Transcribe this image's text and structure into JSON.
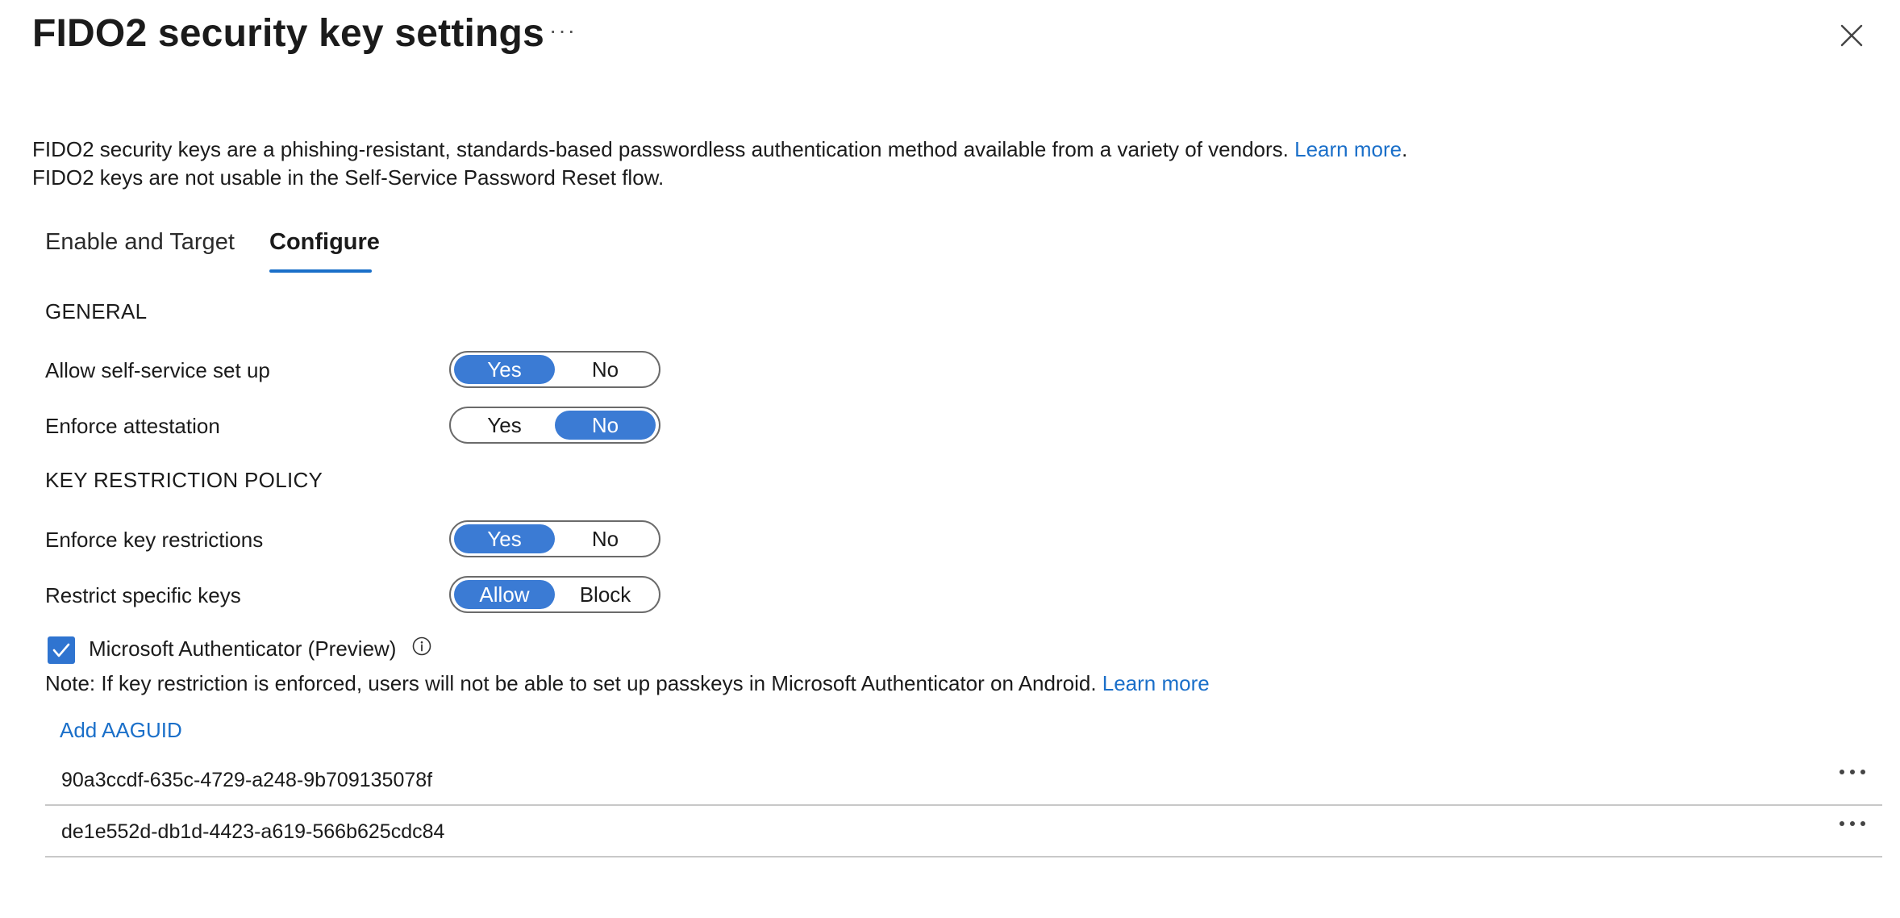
{
  "header": {
    "title": "FIDO2 security key settings",
    "more": "···"
  },
  "description": {
    "line1": "FIDO2 security keys are a phishing-resistant, standards-based passwordless authentication method available from a variety of vendors. ",
    "learn_more": "Learn more",
    "period": ".",
    "line2": "FIDO2 keys are not usable in the Self-Service Password Reset flow."
  },
  "tabs": [
    {
      "label": "Enable and Target",
      "selected": false
    },
    {
      "label": "Configure",
      "selected": true
    }
  ],
  "general": {
    "heading": "GENERAL",
    "allow_self_service": {
      "label": "Allow self-service set up",
      "options": [
        "Yes",
        "No"
      ],
      "selected": "Yes"
    },
    "enforce_attestation": {
      "label": "Enforce attestation",
      "options": [
        "Yes",
        "No"
      ],
      "selected": "No"
    }
  },
  "key_restriction": {
    "heading": "KEY RESTRICTION POLICY",
    "enforce_key_restrictions": {
      "label": "Enforce key restrictions",
      "options": [
        "Yes",
        "No"
      ],
      "selected": "Yes"
    },
    "restrict_specific_keys": {
      "label": "Restrict specific keys",
      "options": [
        "Allow",
        "Block"
      ],
      "selected": "Allow"
    }
  },
  "authenticator": {
    "label": "Microsoft Authenticator (Preview)",
    "checked": true
  },
  "note": {
    "text": "Note: If key restriction is enforced, users will not be able to set up passkeys in Microsoft Authenticator on Android. ",
    "learn_more": "Learn more"
  },
  "add_aaguid_label": "Add AAGUID",
  "aaguids": [
    "90a3ccdf-635c-4729-a248-9b709135078f",
    "de1e552d-db1d-4423-a619-566b625cdc84"
  ],
  "colors": {
    "accent": "#3b7bd4",
    "link": "#1a6fc9"
  }
}
